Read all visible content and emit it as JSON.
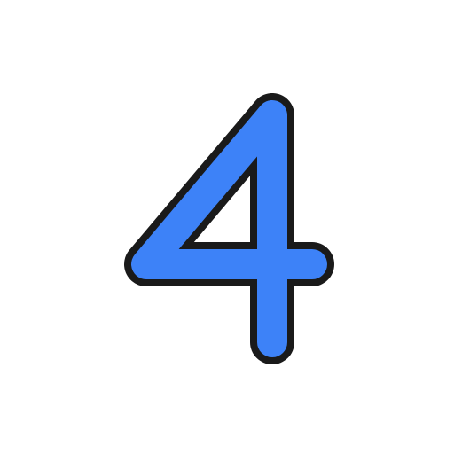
{
  "glyph": {
    "character": "4",
    "icon": "number-four-icon",
    "fill_color": "#3d82f8",
    "outline_color": "#1a1a1a",
    "background_color": "#ffffff"
  }
}
